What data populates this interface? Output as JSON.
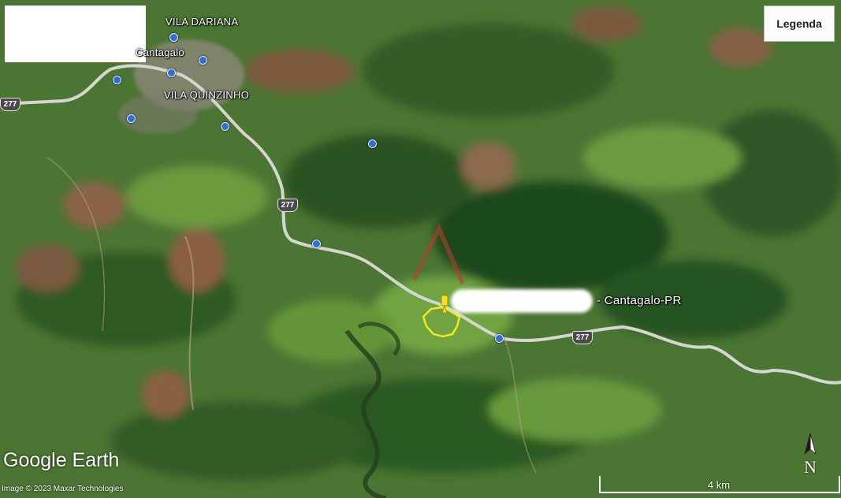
{
  "map": {
    "places": {
      "vila_dariana": "VILA DARIANA",
      "cantagalo_town": "Cantagalo",
      "vila_quinzinho": "VILA QUINZINHO"
    },
    "highway_shields": [
      "277",
      "277",
      "277"
    ],
    "property_label": "- Cantagalo-PR",
    "legend_button": "Legenda",
    "brand": "Google Earth",
    "imagery_credit": "Image © 2023 Maxar Technologies",
    "scale_label": "4 km",
    "north_label": "N",
    "colors": {
      "boundary": "#f2ea16",
      "road": "#d6d6d0",
      "poi_marker": "#2f6fd6",
      "pin": "#f2e21a"
    },
    "icons": [
      "poi-marker-icon",
      "placemark-pin-icon",
      "north-arrow-icon",
      "highway-shield-icon"
    ]
  }
}
